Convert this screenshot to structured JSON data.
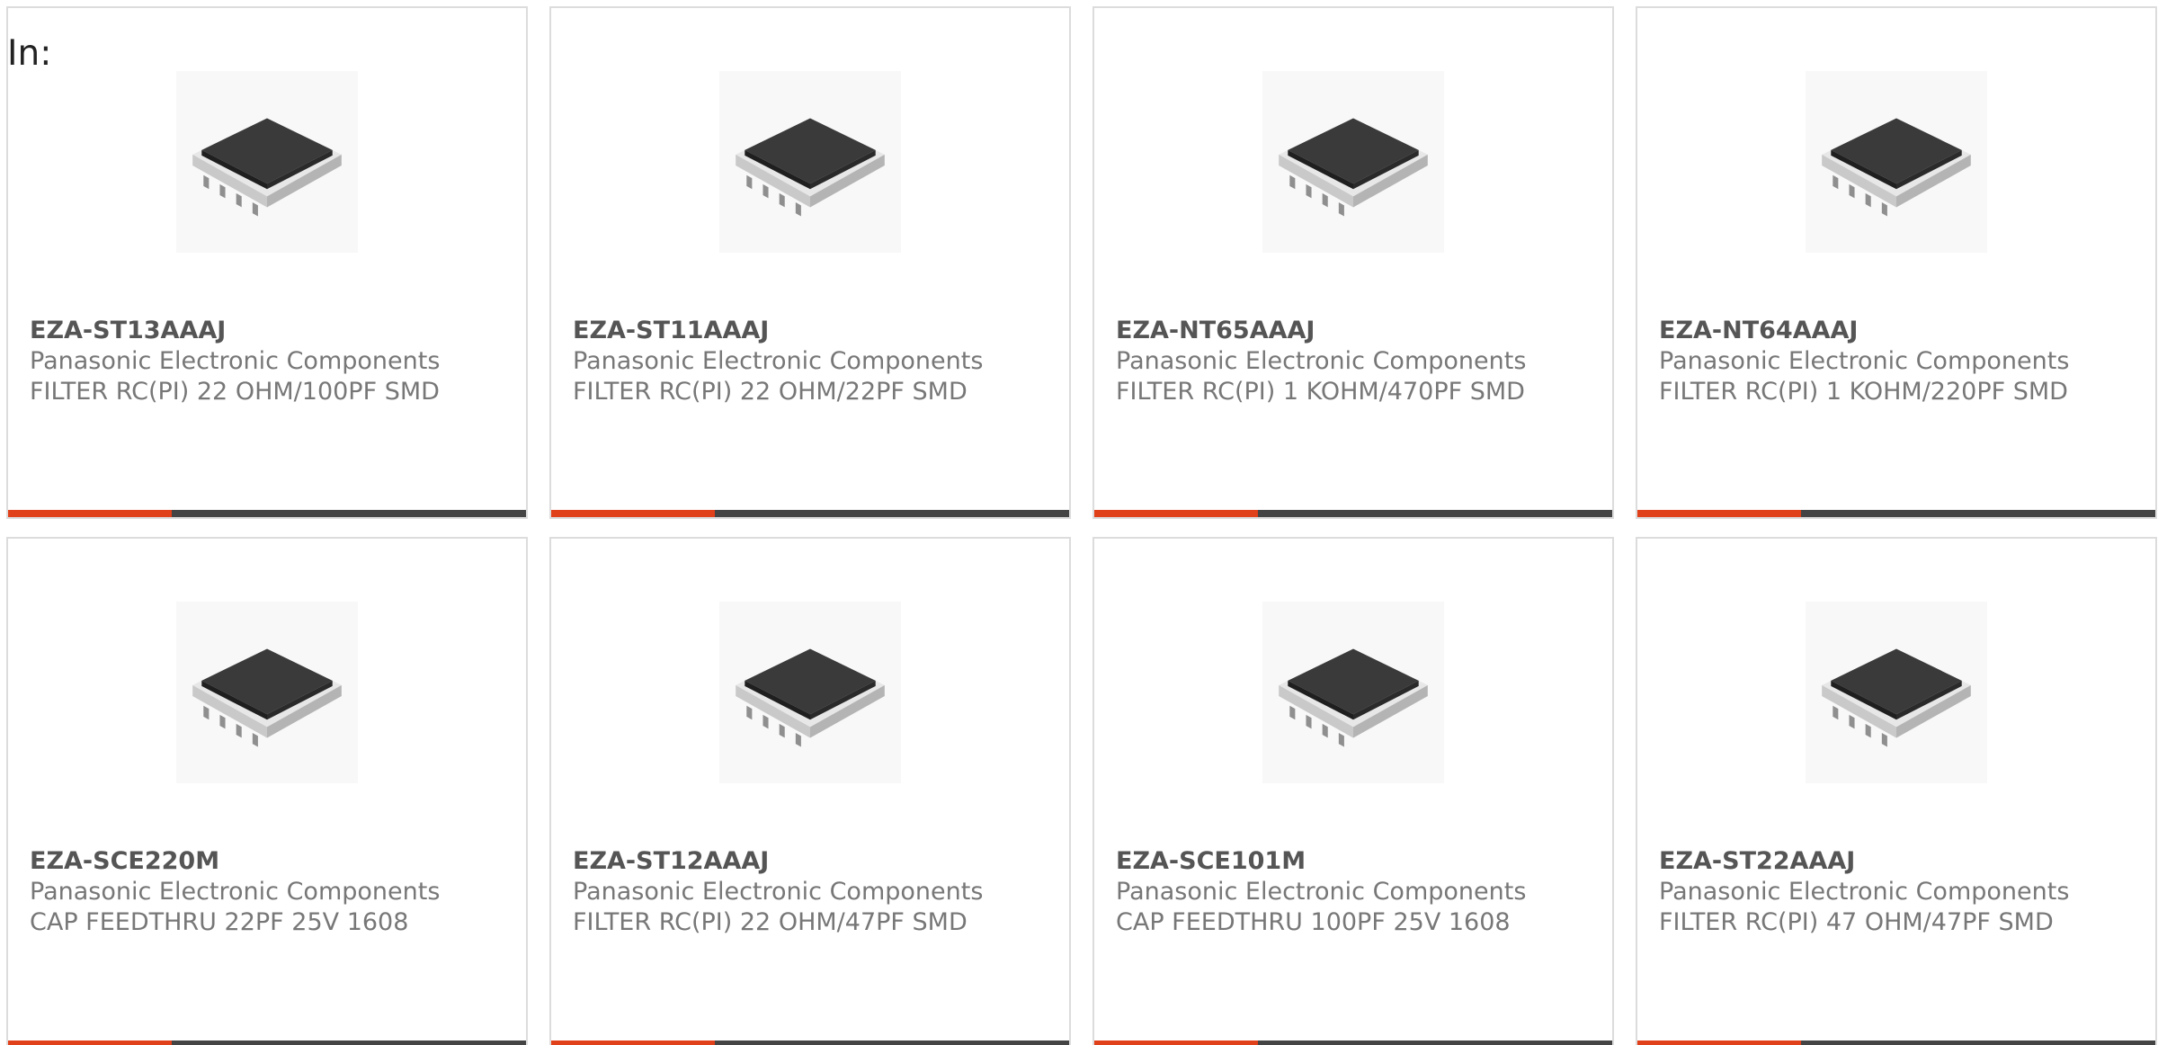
{
  "heading": "In:",
  "colors": {
    "accent_bar": "#e0401a",
    "base_bar": "#444444"
  },
  "cards": [
    {
      "part_number": "EZA-ST13AAAJ",
      "manufacturer": "Panasonic Electronic Components",
      "description": "FILTER RC(PI) 22 OHM/100PF SMD",
      "image_icon": "chip-array-icon"
    },
    {
      "part_number": "EZA-ST11AAAJ",
      "manufacturer": "Panasonic Electronic Components",
      "description": "FILTER RC(PI) 22 OHM/22PF SMD",
      "image_icon": "chip-array-icon"
    },
    {
      "part_number": "EZA-NT65AAAJ",
      "manufacturer": "Panasonic Electronic Components",
      "description": "FILTER RC(PI) 1 KOHM/470PF SMD",
      "image_icon": "chip-array-icon"
    },
    {
      "part_number": "EZA-NT64AAAJ",
      "manufacturer": "Panasonic Electronic Components",
      "description": "FILTER RC(PI) 1 KOHM/220PF SMD",
      "image_icon": "chip-array-icon"
    },
    {
      "part_number": "EZA-SCE220M",
      "manufacturer": "Panasonic Electronic Components",
      "description": "CAP FEEDTHRU 22PF 25V 1608",
      "image_icon": "chip-array-icon"
    },
    {
      "part_number": "EZA-ST12AAAJ",
      "manufacturer": "Panasonic Electronic Components",
      "description": "FILTER RC(PI) 22 OHM/47PF SMD",
      "image_icon": "chip-array-icon"
    },
    {
      "part_number": "EZA-SCE101M",
      "manufacturer": "Panasonic Electronic Components",
      "description": "CAP FEEDTHRU 100PF 25V 1608",
      "image_icon": "chip-array-icon"
    },
    {
      "part_number": "EZA-ST22AAAJ",
      "manufacturer": "Panasonic Electronic Components",
      "description": "FILTER RC(PI) 47 OHM/47PF SMD",
      "image_icon": "chip-array-icon"
    }
  ]
}
